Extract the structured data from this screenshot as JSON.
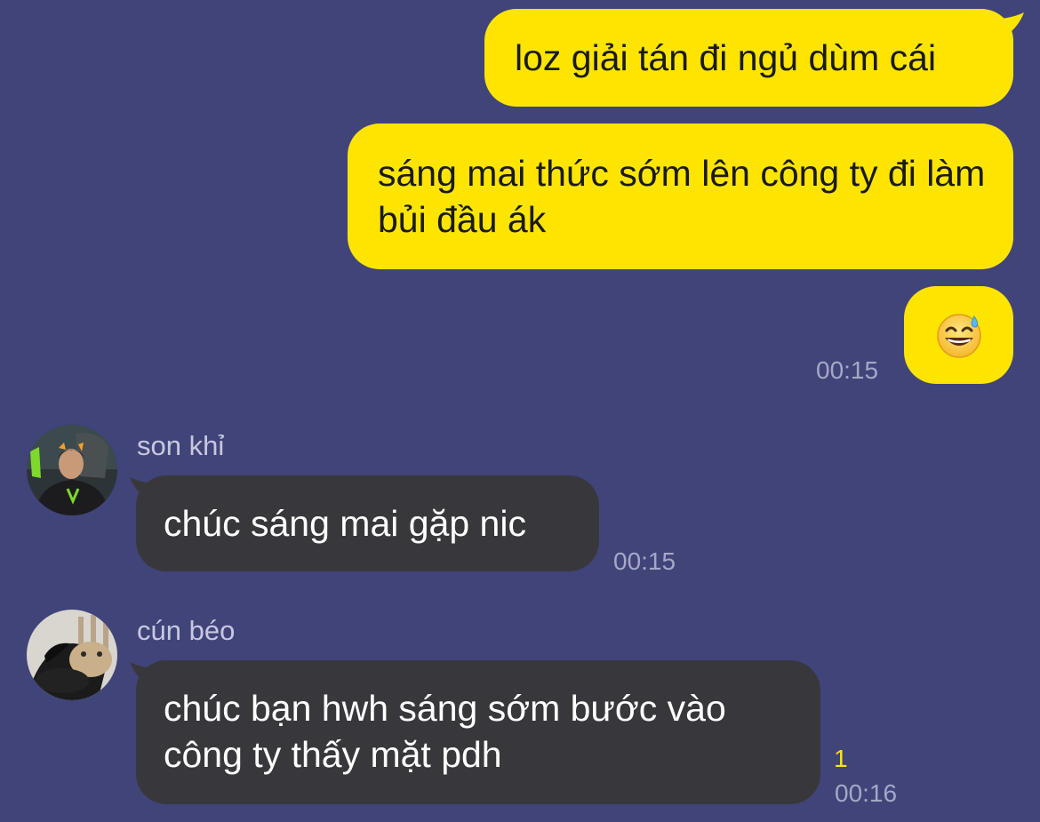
{
  "colors": {
    "background": "#414479",
    "outgoing_bubble": "#FEE501",
    "incoming_bubble": "#38383C",
    "timestamp": "#a5a7c6",
    "unread_count": "#FEE501"
  },
  "outgoing": {
    "msg1": "loz giải tán đi ngủ dùm cái",
    "msg2": "sáng mai thức sớm lên công ty đi làm bủi đầu ák",
    "msg3_emoji": "grinning-face-with-sweat-icon",
    "time": "00:15"
  },
  "incoming": [
    {
      "sender": "son khỉ",
      "avatar": "avatar-photo",
      "text": "chúc sáng mai gặp nic",
      "time": "00:15"
    },
    {
      "sender": "cún béo",
      "avatar": "avatar-photo",
      "text": "chúc bạn hwh sáng sớm bước vào công ty thấy mặt pdh",
      "unread": "1",
      "time": "00:16"
    }
  ]
}
